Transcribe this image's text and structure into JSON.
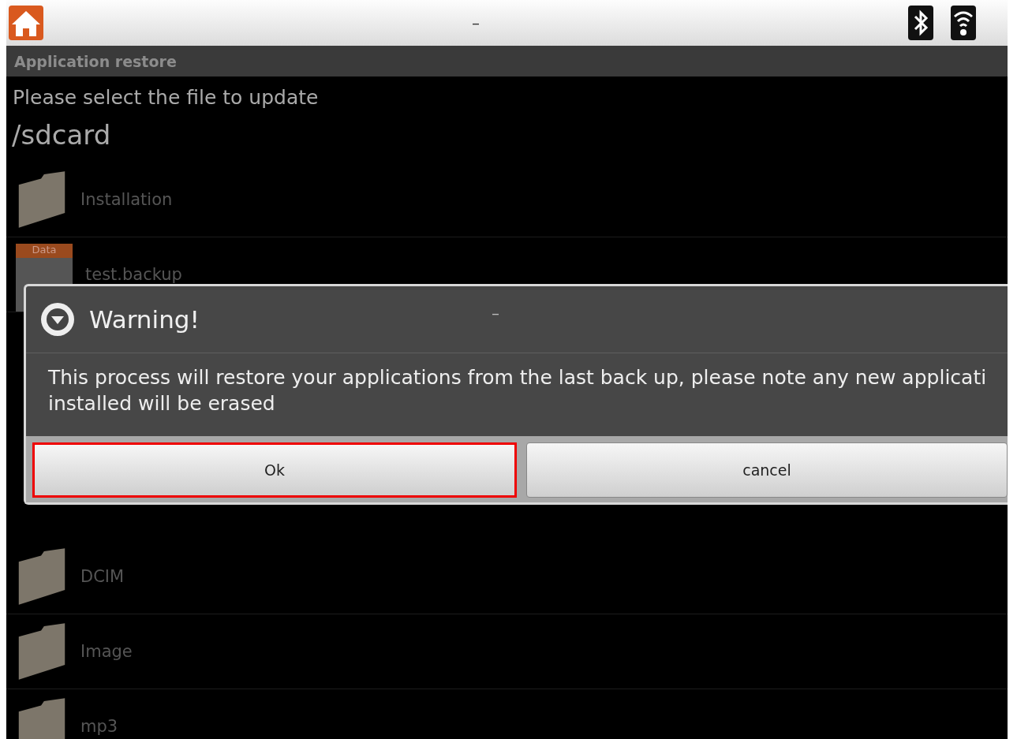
{
  "status_bar": {
    "center_text": "–"
  },
  "title_bar": {
    "title": "Application restore"
  },
  "prompt": "Please select the file to update",
  "path": "/sdcard",
  "files_above": [
    {
      "kind": "folder",
      "name": "Installation"
    },
    {
      "kind": "data",
      "badge": "Data",
      "name": "test.backup"
    }
  ],
  "files_below": [
    {
      "kind": "folder",
      "name": "DCIM"
    },
    {
      "kind": "folder",
      "name": "Image"
    },
    {
      "kind": "folder",
      "name": "mp3"
    }
  ],
  "dialog": {
    "title": "Warning!",
    "center_text": "–",
    "message": "This process will restore your applications from the last back up, please note any new applicati\ninstalled will be erased",
    "buttons": [
      {
        "label": "Ok",
        "selected": true
      },
      {
        "label": "cancel",
        "selected": false
      }
    ]
  }
}
